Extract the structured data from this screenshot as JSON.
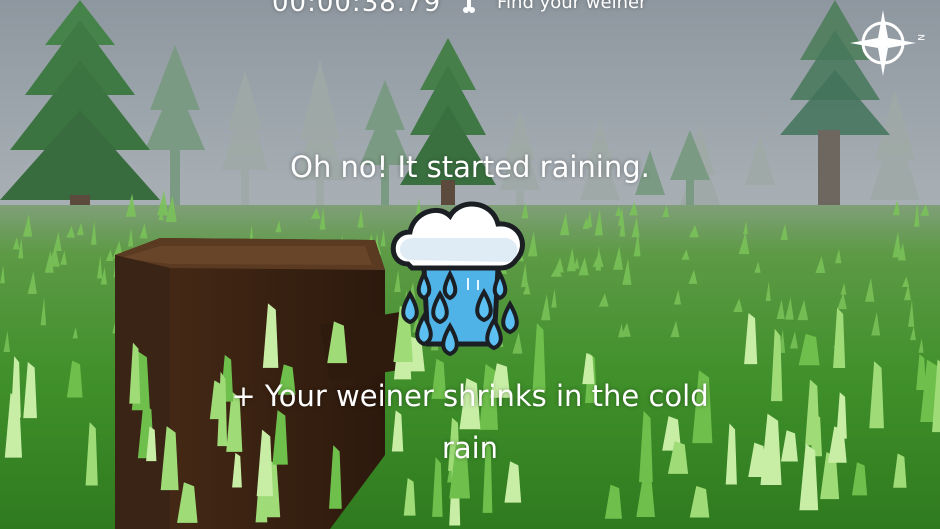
{
  "hud": {
    "timer": "00:00:38.79",
    "objective": "Find your weiner",
    "bone_icon": "bone-icon",
    "compass_icon": "compass-icon"
  },
  "event": {
    "message": "Oh no! It started raining.",
    "icon": "rain-cloud-icon",
    "effect": "+ Your weiner shrinks in the cold rain"
  },
  "colors": {
    "fog": "#a9b1b7",
    "grass": "#3f9a2a",
    "tree": "#3c6e41",
    "stump": "#3a2416",
    "text": "#ffffff",
    "raindrop": "#4fb3e8"
  }
}
